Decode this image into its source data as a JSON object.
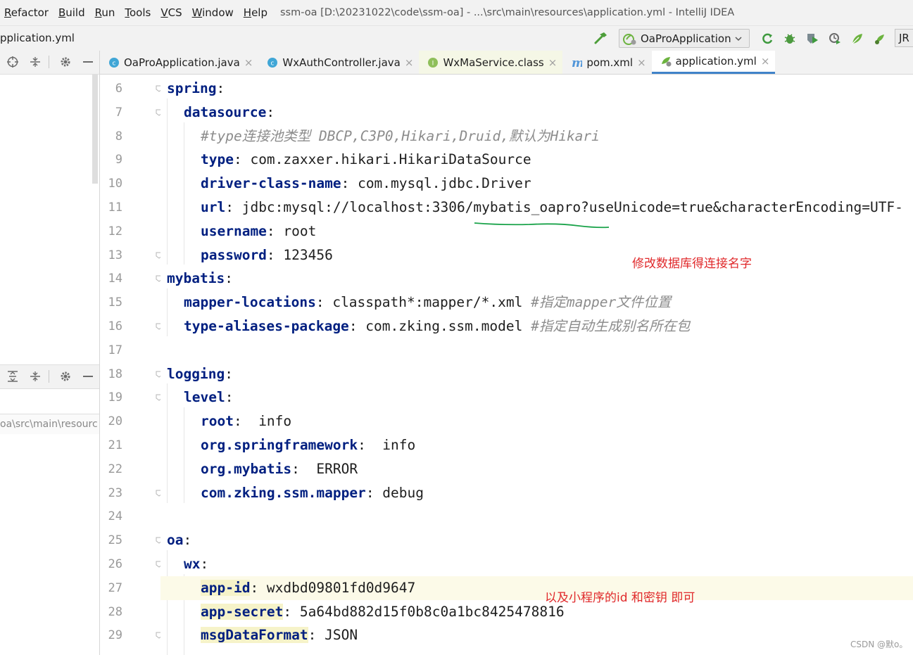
{
  "menu": [
    "Refactor",
    "Build",
    "Run",
    "Tools",
    "VCS",
    "Window",
    "Help"
  ],
  "window_title": "ssm-oa [D:\\20231022\\code\\ssm-oa] - ...\\src\\main\\resources\\application.yml - IntelliJ IDEA",
  "navbar": {
    "breadcrumb_file": "pplication.yml",
    "run_config": "OaProApplication",
    "jre_label": "JR"
  },
  "left_panel": {
    "path_text": "oa\\src\\main\\resourc"
  },
  "tabs": [
    {
      "label": "OaProApplication.java",
      "icon": "class-icon",
      "active": false
    },
    {
      "label": "WxAuthController.java",
      "icon": "class-icon",
      "active": false
    },
    {
      "label": "WxMaService.class",
      "icon": "interface-icon",
      "active": false
    },
    {
      "label": "pom.xml",
      "icon": "maven-icon",
      "active": false
    },
    {
      "label": "application.yml",
      "icon": "spring-yml-icon",
      "active": true
    }
  ],
  "code_lines": [
    {
      "num": "6",
      "indent": 0,
      "parts": [
        {
          "t": "spring",
          "c": "k"
        },
        {
          "t": ":"
        }
      ]
    },
    {
      "num": "7",
      "indent": 1,
      "parts": [
        {
          "t": "datasource",
          "c": "k"
        },
        {
          "t": ":"
        }
      ]
    },
    {
      "num": "8",
      "indent": 2,
      "parts": [
        {
          "t": "#type连接池类型 DBCP,C3P0,Hikari,Druid,默认为Hikari",
          "c": "c"
        }
      ]
    },
    {
      "num": "9",
      "indent": 2,
      "parts": [
        {
          "t": "type",
          "c": "k"
        },
        {
          "t": ": com.zaxxer.hikari.HikariDataSource"
        }
      ]
    },
    {
      "num": "10",
      "indent": 2,
      "parts": [
        {
          "t": "driver-class-name",
          "c": "k"
        },
        {
          "t": ": com.mysql.jdbc.Driver"
        }
      ]
    },
    {
      "num": "11",
      "indent": 2,
      "parts": [
        {
          "t": "url",
          "c": "k"
        },
        {
          "t": ": jdbc:mysql://localhost:3306/mybatis_oapro?useUnicode=true&characterEncoding=UTF-"
        }
      ]
    },
    {
      "num": "12",
      "indent": 2,
      "parts": [
        {
          "t": "username",
          "c": "k"
        },
        {
          "t": ": root"
        }
      ]
    },
    {
      "num": "13",
      "indent": 2,
      "parts": [
        {
          "t": "password",
          "c": "k"
        },
        {
          "t": ": 123456"
        }
      ]
    },
    {
      "num": "14",
      "indent": 0,
      "parts": [
        {
          "t": "mybatis",
          "c": "k"
        },
        {
          "t": ":"
        }
      ]
    },
    {
      "num": "15",
      "indent": 1,
      "parts": [
        {
          "t": "mapper-locations",
          "c": "k"
        },
        {
          "t": ": classpath*:mapper/*.xml "
        },
        {
          "t": "#指定mapper文件位置",
          "c": "c"
        }
      ]
    },
    {
      "num": "16",
      "indent": 1,
      "parts": [
        {
          "t": "type-aliases-package",
          "c": "k"
        },
        {
          "t": ": com.zking.ssm.model "
        },
        {
          "t": "#指定自动生成别名所在包",
          "c": "c"
        }
      ]
    },
    {
      "num": "17",
      "indent": 0,
      "parts": []
    },
    {
      "num": "18",
      "indent": 0,
      "parts": [
        {
          "t": "logging",
          "c": "k"
        },
        {
          "t": ":"
        }
      ]
    },
    {
      "num": "19",
      "indent": 1,
      "parts": [
        {
          "t": "level",
          "c": "k"
        },
        {
          "t": ":"
        }
      ]
    },
    {
      "num": "20",
      "indent": 2,
      "parts": [
        {
          "t": "root",
          "c": "k"
        },
        {
          "t": ":  info"
        }
      ]
    },
    {
      "num": "21",
      "indent": 2,
      "parts": [
        {
          "t": "org.springframework",
          "c": "k"
        },
        {
          "t": ":  info"
        }
      ]
    },
    {
      "num": "22",
      "indent": 2,
      "parts": [
        {
          "t": "org.mybatis",
          "c": "k"
        },
        {
          "t": ":  ERROR"
        }
      ]
    },
    {
      "num": "23",
      "indent": 2,
      "parts": [
        {
          "t": "com.zking.ssm.mapper",
          "c": "k"
        },
        {
          "t": ": debug"
        }
      ]
    },
    {
      "num": "24",
      "indent": 0,
      "parts": []
    },
    {
      "num": "25",
      "indent": 0,
      "parts": [
        {
          "t": "oa",
          "c": "k"
        },
        {
          "t": ":"
        }
      ]
    },
    {
      "num": "26",
      "indent": 1,
      "parts": [
        {
          "t": "wx",
          "c": "k"
        },
        {
          "t": ":"
        }
      ]
    },
    {
      "num": "27",
      "indent": 2,
      "highlight": true,
      "parts": [
        {
          "t": "app-id",
          "c": "k hlk"
        },
        {
          "t": ": wxdbd09801fd0d9647"
        }
      ]
    },
    {
      "num": "28",
      "indent": 2,
      "parts": [
        {
          "t": "app-secret",
          "c": "k hlk"
        },
        {
          "t": ": 5a64bd882d15f0b8c0a1bc8425478816"
        }
      ]
    },
    {
      "num": "29",
      "indent": 2,
      "parts": [
        {
          "t": "msgDataFormat",
          "c": "k hlk"
        },
        {
          "t": ": JSON"
        }
      ]
    }
  ],
  "fold_markers": [
    "6",
    "7",
    "13",
    "14",
    "16",
    "18",
    "19",
    "23",
    "25",
    "26",
    "29"
  ],
  "annotations": {
    "db_note": "修改数据库得连接名字",
    "wx_note": "以及小程序的id  和密钥 即可"
  },
  "watermark": "CSDN @默o。",
  "colors": {
    "keyword": "#001f80",
    "comment": "#8c8c8c",
    "annotation": "#e0292b",
    "underline": "#1aa34a",
    "active_tab_border": "#4083c9"
  }
}
